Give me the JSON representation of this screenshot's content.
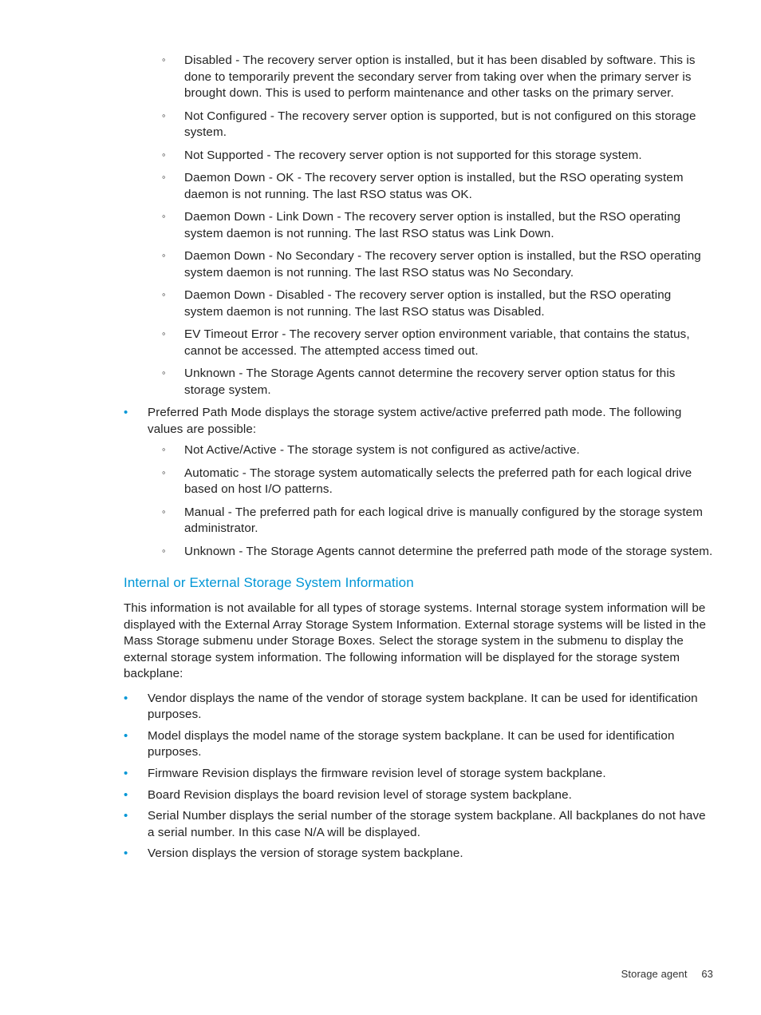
{
  "recoveryServerStatuses": [
    "Disabled - The recovery server option is installed, but it has been disabled by software. This is done to temporarily prevent the secondary server from taking over when the primary server is brought down. This is used to perform maintenance and other tasks on the primary server.",
    "Not Configured - The recovery server option is supported, but is not configured on this storage system.",
    "Not Supported - The recovery server option is not supported for this storage system.",
    "Daemon Down - OK - The recovery server option is installed, but the RSO operating system daemon is not running. The last RSO status was OK.",
    "Daemon Down - Link Down - The recovery server option is installed, but the RSO operating system daemon is not running. The last RSO status was Link Down.",
    "Daemon Down - No Secondary - The recovery server option is installed, but the RSO operating system daemon is not running. The last RSO status was No Secondary.",
    "Daemon Down - Disabled - The recovery server option is installed, but the RSO operating system daemon is not running. The last RSO status was Disabled.",
    "EV Timeout Error - The recovery server option environment variable, that contains the status, cannot be accessed. The attempted access timed out.",
    "Unknown - The Storage Agents cannot determine the recovery server option status for this storage system."
  ],
  "preferredPathIntro": "Preferred Path Mode displays the storage system active/active preferred path mode. The following values are possible:",
  "preferredPathValues": [
    "Not Active/Active - The storage system is not configured as active/active.",
    "Automatic - The storage system automatically selects the preferred path for each logical drive based on host I/O patterns.",
    "Manual - The preferred path for each logical drive is manually configured by the storage system administrator.",
    "Unknown - The Storage Agents cannot determine the preferred path mode of the storage system."
  ],
  "sectionHeading": "Internal or External Storage System Information",
  "sectionBody": "This information is not available for all types of storage systems. Internal storage system information will be displayed with the External Array Storage System Information. External storage systems will be listed in the Mass Storage submenu under Storage Boxes. Select the storage system in the submenu to display the external storage system information. The following information will be displayed for the storage system backplane:",
  "backplaneItems": [
    "Vendor displays the name of the vendor of storage system backplane. It can be used for identification purposes.",
    "Model displays the model name of the storage system backplane. It can be used for identification purposes.",
    "Firmware Revision displays the firmware revision level of storage system backplane.",
    "Board Revision displays the board revision level of storage system backplane.",
    "Serial Number displays the serial number of the storage system backplane. All backplanes do not have a serial number. In this case N/A will be displayed.",
    "Version displays the version of storage system backplane."
  ],
  "footer": {
    "label": "Storage agent",
    "page": "63"
  }
}
